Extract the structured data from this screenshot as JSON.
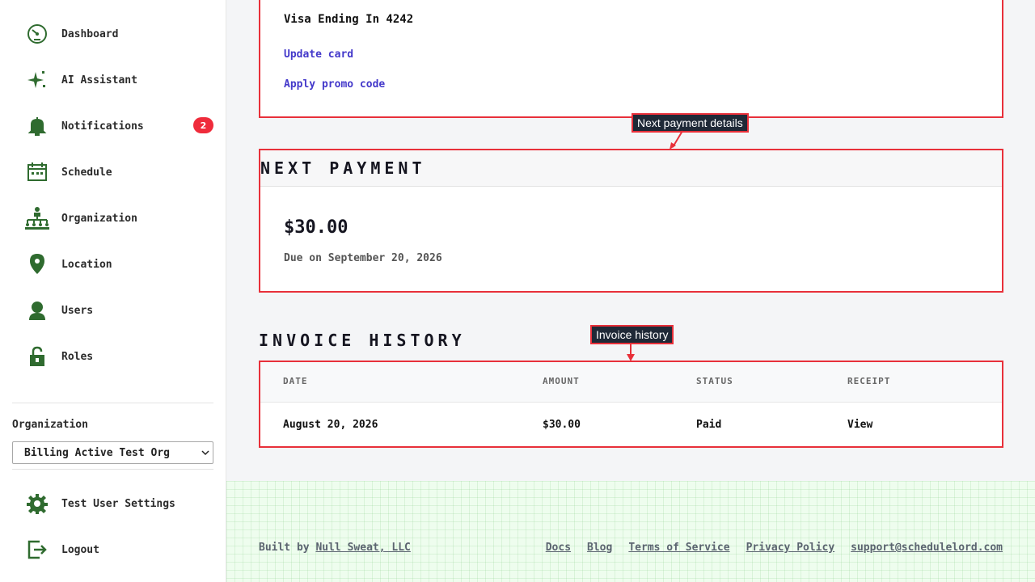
{
  "sidebar": {
    "items": [
      {
        "label": "Dashboard",
        "icon": "dashboard-gauge-icon"
      },
      {
        "label": "AI Assistant",
        "icon": "sparkle-icon"
      },
      {
        "label": "Notifications",
        "icon": "bell-icon",
        "badge": "2"
      },
      {
        "label": "Schedule",
        "icon": "calendar-icon"
      },
      {
        "label": "Organization",
        "icon": "org-chart-icon"
      },
      {
        "label": "Location",
        "icon": "map-pin-icon"
      },
      {
        "label": "Users",
        "icon": "user-icon"
      },
      {
        "label": "Roles",
        "icon": "lock-icon"
      }
    ],
    "organization_label": "Organization",
    "organization_selected": "Billing Active Test Org",
    "bottom_items": [
      {
        "label": "Test User Settings",
        "icon": "gear-icon"
      },
      {
        "label": "Logout",
        "icon": "logout-icon"
      }
    ]
  },
  "payment_method": {
    "card_text": "Visa Ending In 4242",
    "update_card": "Update card",
    "apply_promo": "Apply promo code"
  },
  "next_payment": {
    "title": "Next Payment",
    "amount": "$30.00",
    "due": "Due on September 20, 2026",
    "callout": "Next payment details"
  },
  "invoice_history": {
    "title": "Invoice History",
    "callout": "Invoice history",
    "columns": [
      "DATE",
      "AMOUNT",
      "STATUS",
      "RECEIPT"
    ],
    "rows": [
      {
        "date": "August 20, 2026",
        "amount": "$30.00",
        "status": "Paid",
        "receipt": "View"
      }
    ]
  },
  "footer": {
    "built_by": "Built by",
    "company": "Null Sweat, LLC",
    "links": [
      "Docs",
      "Blog",
      "Terms of Service",
      "Privacy Policy",
      "support@schedulelord.com"
    ]
  },
  "colors": {
    "accent_green": "#2f6b2f",
    "highlight_red": "#e8303a",
    "link_blue": "#4338ca",
    "badge_red": "#ef2b3b"
  }
}
